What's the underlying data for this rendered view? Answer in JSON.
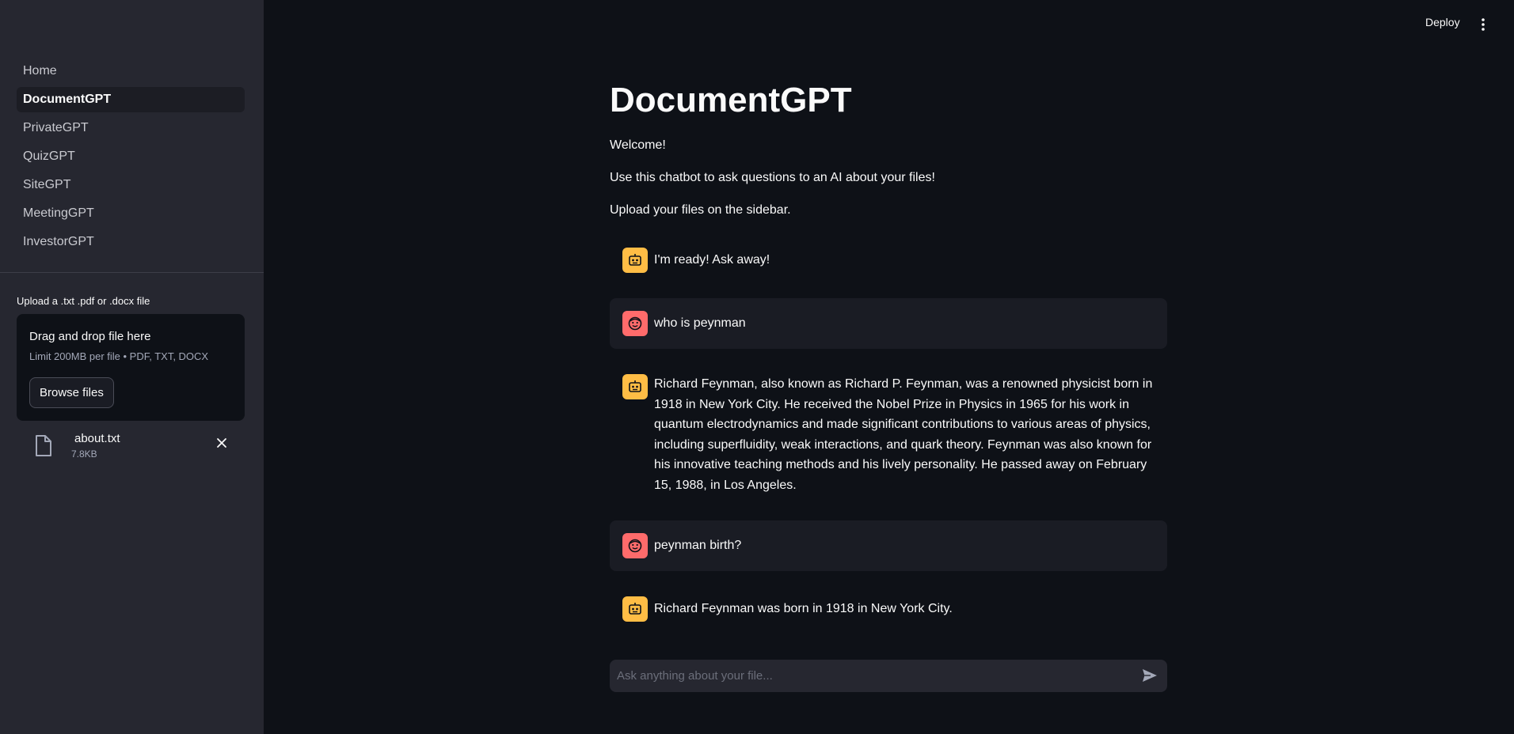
{
  "sidebar": {
    "nav_items": [
      {
        "label": "Home"
      },
      {
        "label": "DocumentGPT"
      },
      {
        "label": "PrivateGPT"
      },
      {
        "label": "QuizGPT"
      },
      {
        "label": "SiteGPT"
      },
      {
        "label": "MeetingGPT"
      },
      {
        "label": "InvestorGPT"
      }
    ],
    "active_item": "DocumentGPT",
    "uploader": {
      "label": "Upload a .txt .pdf or .docx file",
      "dropzone_title": "Drag and drop file here",
      "dropzone_limit": "Limit 200MB per file • PDF, TXT, DOCX",
      "browse_label": "Browse files",
      "file": {
        "name": "about.txt",
        "size": "7.8KB"
      }
    }
  },
  "header": {
    "deploy_label": "Deploy"
  },
  "main": {
    "title": "DocumentGPT",
    "intro": [
      "Welcome!",
      "Use this chatbot to ask questions to an AI about your files!",
      "Upload your files on the sidebar."
    ],
    "messages": [
      {
        "role": "ai",
        "text": "I'm ready! Ask away!"
      },
      {
        "role": "human",
        "text": "who is peynman"
      },
      {
        "role": "ai",
        "text": "Richard Feynman, also known as Richard P. Feynman, was a renowned physicist born in 1918 in New York City. He received the Nobel Prize in Physics in 1965 for his work in quantum electrodynamics and made significant contributions to various areas of physics, including superfluidity, weak interactions, and quark theory. Feynman was also known for his innovative teaching methods and his lively personality. He passed away on February 15, 1988, in Los Angeles."
      },
      {
        "role": "human",
        "text": "peynman birth?"
      },
      {
        "role": "ai",
        "text": "Richard Feynman was born in 1918 in New York City."
      }
    ],
    "chat_input": {
      "placeholder": "Ask anything about your file..."
    }
  },
  "colors": {
    "background": "#0e1117",
    "sidebar": "#262730",
    "bot_avatar": "#ffbd45",
    "user_avatar": "#ff6b6b"
  },
  "icons": {
    "bot": "robot-icon",
    "user": "face-icon",
    "file": "file-icon",
    "remove": "close-icon",
    "send": "send-icon",
    "menu": "vertical-dots-icon"
  }
}
